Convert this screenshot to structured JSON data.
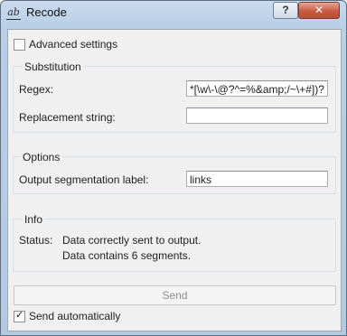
{
  "window": {
    "title": "Recode",
    "help_label": "?",
    "close_label": "✕",
    "app_icon_text": "ab"
  },
  "advanced": {
    "label": "Advanced settings",
    "checked": false
  },
  "substitution": {
    "title": "Substitution",
    "regex_label": "Regex:",
    "regex_value": "*[\\w\\-\\@?^=%&amp;/~\\+#])?",
    "replacement_label": "Replacement string:",
    "replacement_value": ""
  },
  "options": {
    "title": "Options",
    "segmentation_label": "Output segmentation label:",
    "segmentation_value": "links"
  },
  "info": {
    "title": "Info",
    "status_label": "Status:",
    "line1": "Data correctly sent to output.",
    "line2": "Data contains 6 segments."
  },
  "footer": {
    "send_label": "Send",
    "send_enabled": false,
    "auto_label": "Send automatically",
    "auto_checked": true
  }
}
